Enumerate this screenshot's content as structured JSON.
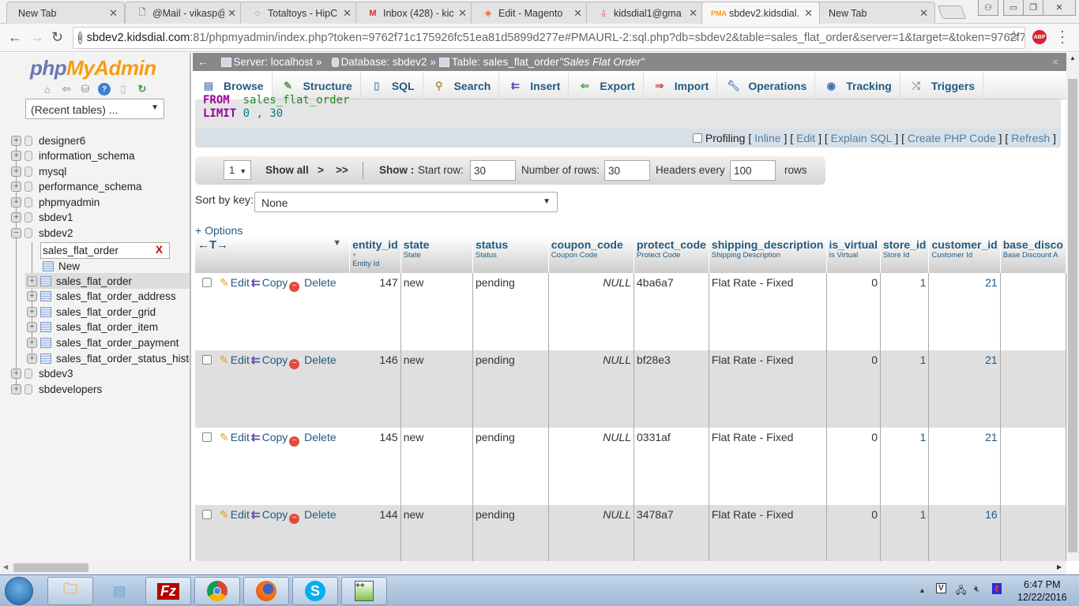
{
  "browser": {
    "tabs": [
      {
        "label": "New Tab",
        "icon": "none",
        "active": false
      },
      {
        "label": "@Mail - vikasp@",
        "icon": "document-icon",
        "active": false
      },
      {
        "label": "Totaltoys - HipC",
        "icon": "hipchat-icon",
        "active": false
      },
      {
        "label": "Inbox (428) - kic",
        "icon": "gmail-icon",
        "active": false
      },
      {
        "label": "Edit - Magento",
        "icon": "magento-icon",
        "active": false
      },
      {
        "label": "kidsdial1@gma",
        "icon": "magento-icon",
        "active": false
      },
      {
        "label": "sbdev2.kidsdial.",
        "icon": "pma-icon",
        "active": true
      },
      {
        "label": "New Tab",
        "icon": "none",
        "active": false
      }
    ],
    "url_host": "sbdev2.kidsdial.com",
    "url_rest": ":81/phpmyadmin/index.php?token=9762f71c175926fc51ea81d5899d277e#PMAURL-2:sql.php?db=sbdev2&table=sales_flat_order&server=1&target=&token=9762f7",
    "abp_label": "ABP"
  },
  "sidebar": {
    "logo_php": "php",
    "logo_myadmin": "MyAdmin",
    "recent_tables": "(Recent tables) ...",
    "databases": [
      "designer6",
      "information_schema",
      "mysql",
      "performance_schema",
      "phpmyadmin",
      "sbdev1",
      "sbdev2",
      "sbdev3",
      "sbdevelopers"
    ],
    "filter_value": "sales_flat_order",
    "filter_clear": "X",
    "new_label": "New",
    "tables": [
      "sales_flat_order",
      "sales_flat_order_address",
      "sales_flat_order_grid",
      "sales_flat_order_item",
      "sales_flat_order_payment",
      "sales_flat_order_status_histo"
    ]
  },
  "breadcrumb": {
    "server": "Server: localhost",
    "database": "Database: sbdev2",
    "table": "Table: sales_flat_order",
    "table_comment": "\"Sales Flat Order\"",
    "sep": "»"
  },
  "menu": [
    "Browse",
    "Structure",
    "SQL",
    "Search",
    "Insert",
    "Export",
    "Import",
    "Operations",
    "Tracking",
    "Triggers"
  ],
  "sql": {
    "from_kw": "FROM",
    "table": "sales_flat_order",
    "limit_kw": "LIMIT",
    "limit_val": "0 , 30"
  },
  "sql_tools": {
    "profiling": "Profiling",
    "inline": "Inline",
    "edit": "Edit",
    "explain": "Explain SQL",
    "php": "Create PHP Code",
    "refresh": "Refresh"
  },
  "nav": {
    "page": "1",
    "show_all": "Show all",
    "next": ">",
    "last": ">>",
    "show_label": "Show :",
    "start_row_label": "Start row:",
    "start_row": "30",
    "num_rows_label": "Number of rows:",
    "num_rows": "30",
    "headers_every_label": "Headers every",
    "headers_every": "100",
    "rows_label": "rows"
  },
  "sort": {
    "label": "Sort by key:",
    "value": "None"
  },
  "options_label": "+ Options",
  "table": {
    "columns": [
      {
        "name": "entity_id",
        "comment": "Entity Id"
      },
      {
        "name": "state",
        "comment": "State"
      },
      {
        "name": "status",
        "comment": "Status"
      },
      {
        "name": "coupon_code",
        "comment": "Coupon Code"
      },
      {
        "name": "protect_code",
        "comment": "Protect Code"
      },
      {
        "name": "shipping_description",
        "comment": "Shipping Description"
      },
      {
        "name": "is_virtual",
        "comment": "Is Virtual"
      },
      {
        "name": "store_id",
        "comment": "Store Id"
      },
      {
        "name": "customer_id",
        "comment": "Customer Id"
      },
      {
        "name": "base_disco",
        "comment": "Base Discount A"
      }
    ],
    "actions": {
      "edit": "Edit",
      "copy": "Copy",
      "delete": "Delete"
    },
    "rows": [
      {
        "entity_id": "147",
        "state": "new",
        "status": "pending",
        "coupon_code": "NULL",
        "protect_code": "4ba6a7",
        "shipping_description": "Flat Rate - Fixed",
        "is_virtual": "0",
        "store_id": "1",
        "customer_id": "21"
      },
      {
        "entity_id": "146",
        "state": "new",
        "status": "pending",
        "coupon_code": "NULL",
        "protect_code": "bf28e3",
        "shipping_description": "Flat Rate - Fixed",
        "is_virtual": "0",
        "store_id": "1",
        "customer_id": "21"
      },
      {
        "entity_id": "145",
        "state": "new",
        "status": "pending",
        "coupon_code": "NULL",
        "protect_code": "0331af",
        "shipping_description": "Flat Rate - Fixed",
        "is_virtual": "0",
        "store_id": "1",
        "customer_id": "21"
      },
      {
        "entity_id": "144",
        "state": "new",
        "status": "pending",
        "coupon_code": "NULL",
        "protect_code": "3478a7",
        "shipping_description": "Flat Rate - Fixed",
        "is_virtual": "0",
        "store_id": "1",
        "customer_id": "16"
      }
    ]
  },
  "taskbar": {
    "apps": [
      "explorer",
      "notepad",
      "filezilla",
      "chrome",
      "firefox",
      "skype",
      "notepad++"
    ],
    "time": "6:47 PM",
    "date": "12/22/2016"
  }
}
